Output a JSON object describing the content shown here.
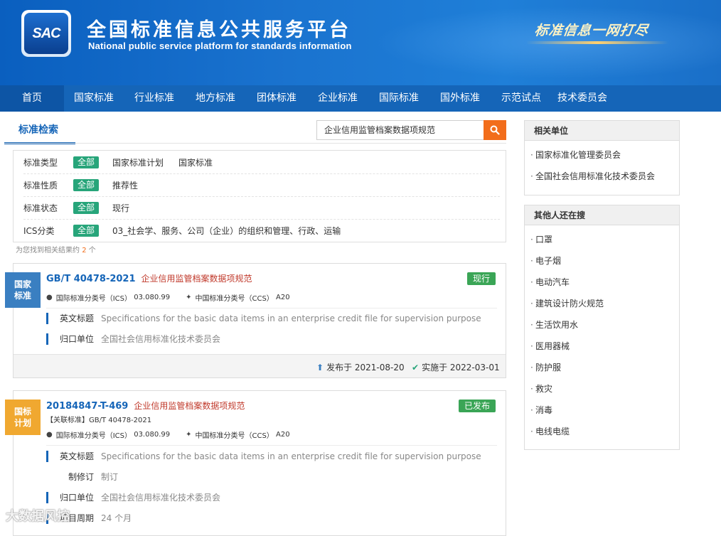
{
  "header": {
    "logo_text": "SAC",
    "title": "全国标准信息公共服务平台",
    "subtitle": "National public service platform  for standards information",
    "slogan": "标准信息一网打尽"
  },
  "nav": {
    "items": [
      "首页",
      "国家标准",
      "行业标准",
      "地方标准",
      "团体标准",
      "企业标准",
      "国际标准",
      "国外标准",
      "示范试点",
      "技术委员会"
    ],
    "active_index": 0
  },
  "search": {
    "tab_label": "标准检索",
    "query": "企业信用监管档案数据项规范",
    "button_icon": "search-icon"
  },
  "filters": [
    {
      "label": "标准类型",
      "all": "全部",
      "options": [
        "国家标准计划",
        "国家标准"
      ]
    },
    {
      "label": "标准性质",
      "all": "全部",
      "options": [
        "推荐性"
      ]
    },
    {
      "label": "标准状态",
      "all": "全部",
      "options": [
        "现行"
      ]
    },
    {
      "label": "ICS分类",
      "all": "全部",
      "options": [
        "03_社会学、服务、公司（企业）的组织和管理、行政、运输"
      ]
    }
  ],
  "result_count": {
    "prefix": "为您找到相关结果约",
    "count": "2",
    "suffix": "个"
  },
  "results": [
    {
      "badge": "国家标准",
      "badge_line1": "国家",
      "badge_line2": "标准",
      "badge_color": "#3a7fc1",
      "code": "GB/T 40478-2021",
      "name": "企业信用监管档案数据项规范",
      "status": "现行",
      "ics_label": "国际标准分类号（ICS）",
      "ics": "03.080.99",
      "ccs_label": "中国标准分类号（CCS）",
      "ccs": "A20",
      "details": [
        {
          "label": "英文标题",
          "value": "Specifications for the basic data items in an enterprise credit file for supervision purpose"
        },
        {
          "label": "归口单位",
          "value": "全国社会信用标准化技术委员会"
        }
      ],
      "published": "发布于 2021-08-20",
      "implemented": "实施于 2022-03-01"
    },
    {
      "badge_line1": "国标",
      "badge_line2": "计划",
      "badge_color": "#f0a830",
      "code": "20184847-T-469",
      "name": "企业信用监管档案数据项规范",
      "status": "已发布",
      "related": "【关联标准】GB/T 40478-2021",
      "ics_label": "国际标准分类号（ICS）",
      "ics": "03.080.99",
      "ccs_label": "中国标准分类号（CCS）",
      "ccs": "A20",
      "details": [
        {
          "label": "英文标题",
          "value": "Specifications for the basic data items in an enterprise credit file for supervision purpose"
        },
        {
          "label": "制修订",
          "value": "制订"
        },
        {
          "label": "归口单位",
          "value": "全国社会信用标准化技术委员会"
        },
        {
          "label": "项目周期",
          "value": "24 个月"
        }
      ]
    }
  ],
  "sidebar": {
    "related_title": "相关单位",
    "related": [
      "国家标准化管理委员会",
      "全国社会信用标准化技术委员会"
    ],
    "others_title": "其他人还在搜",
    "others": [
      "口罩",
      "电子烟",
      "电动汽车",
      "建筑设计防火规范",
      "生活饮用水",
      "医用器械",
      "防护服",
      "救灾",
      "消毒",
      "电线电缆"
    ]
  },
  "watermark": "大数据风控",
  "colors": {
    "nav": "#1565b8",
    "accent": "#f26d1b",
    "green": "#27a57a",
    "status": "#3aa556",
    "title_red": "#c0392b"
  }
}
